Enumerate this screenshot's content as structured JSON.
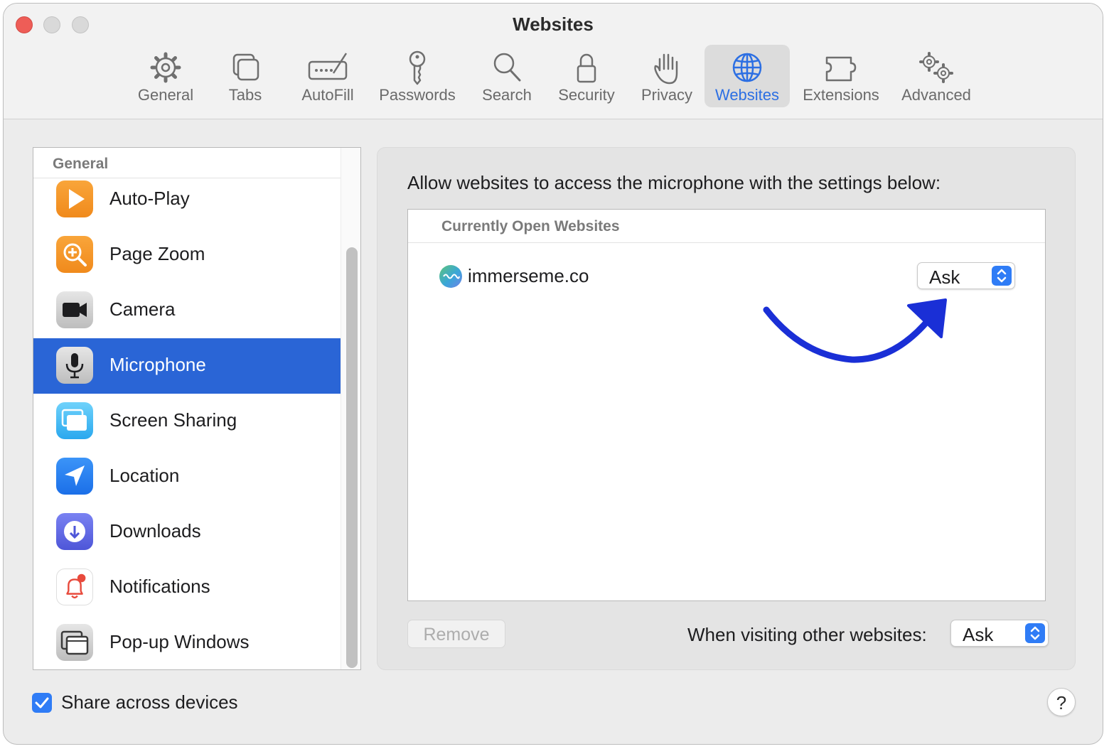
{
  "window": {
    "title": "Websites"
  },
  "toolbar": {
    "items": [
      {
        "label": "General",
        "icon": "gear-icon"
      },
      {
        "label": "Tabs",
        "icon": "tabs-icon"
      },
      {
        "label": "AutoFill",
        "icon": "autofill-icon"
      },
      {
        "label": "Passwords",
        "icon": "key-icon"
      },
      {
        "label": "Search",
        "icon": "magnifier-icon"
      },
      {
        "label": "Security",
        "icon": "lock-icon"
      },
      {
        "label": "Privacy",
        "icon": "hand-icon"
      },
      {
        "label": "Websites",
        "icon": "globe-icon",
        "selected": true
      },
      {
        "label": "Extensions",
        "icon": "puzzle-icon"
      },
      {
        "label": "Advanced",
        "icon": "gears-icon"
      }
    ]
  },
  "sidebar": {
    "header": "General",
    "items": [
      {
        "label": "Auto-Play",
        "icon": "play-icon"
      },
      {
        "label": "Page Zoom",
        "icon": "zoom-icon"
      },
      {
        "label": "Camera",
        "icon": "camera-icon"
      },
      {
        "label": "Microphone",
        "icon": "microphone-icon",
        "selected": true
      },
      {
        "label": "Screen Sharing",
        "icon": "screen-sharing-icon"
      },
      {
        "label": "Location",
        "icon": "location-arrow-icon"
      },
      {
        "label": "Downloads",
        "icon": "download-icon"
      },
      {
        "label": "Notifications",
        "icon": "bell-icon"
      },
      {
        "label": "Pop-up Windows",
        "icon": "popup-window-icon"
      }
    ]
  },
  "main": {
    "heading": "Allow websites to access the microphone with the settings below:",
    "table_header": "Currently Open Websites",
    "sites": [
      {
        "name": "immerseme.co",
        "setting": "Ask"
      }
    ],
    "remove_label": "Remove",
    "other_label": "When visiting other websites:",
    "other_value": "Ask"
  },
  "footer": {
    "share_label": "Share across devices",
    "share_checked": true,
    "help_label": "?"
  },
  "colors": {
    "accent": "#2a65d6",
    "arrow": "#1a2fd6"
  }
}
